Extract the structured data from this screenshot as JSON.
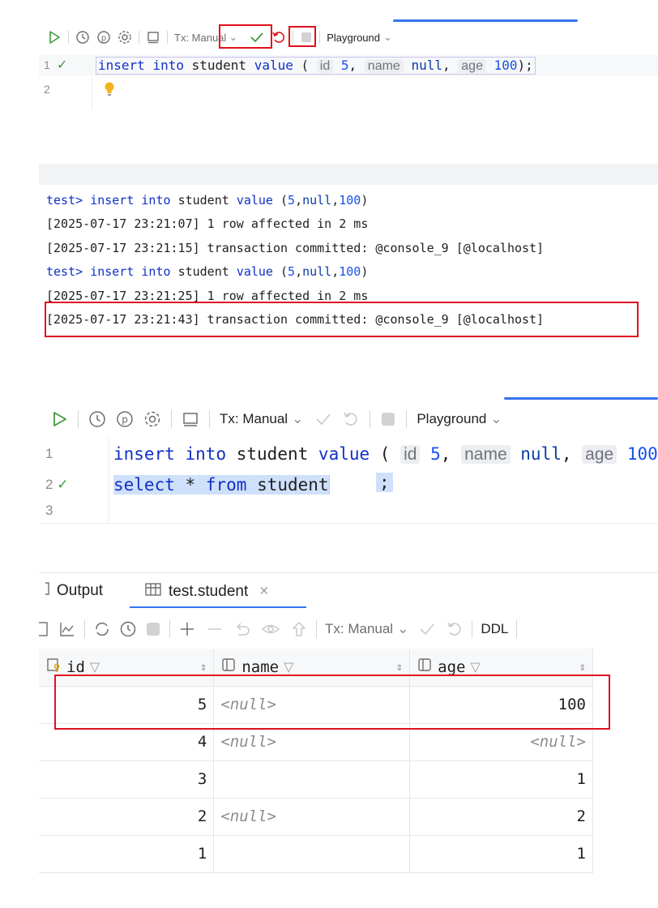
{
  "editor1": {
    "toolbar": {
      "tx_mode": "Tx: Manual",
      "playground": "Playground"
    },
    "lines": [
      {
        "number": "1",
        "status": "✓",
        "kw_insert": "insert",
        "kw_into": "into",
        "table": "student",
        "kw_value": "value",
        "paren_open": "(",
        "hint_id": "id",
        "val_id": "5",
        "comma1": ",",
        "hint_name": "name",
        "val_name": "null",
        "comma2": ",",
        "hint_age": "age",
        "val_age": "100",
        "paren_close": ");"
      },
      {
        "number": "2"
      }
    ]
  },
  "console": {
    "lines": [
      {
        "prompt": "test>",
        "kw1": "insert",
        "kw2": "into",
        "table": "student",
        "kw3": "value",
        "open": "(",
        "v1": "5",
        "c1": ",",
        "v2": "null",
        "c2": ",",
        "v3": "100",
        "close": ")"
      },
      {
        "text": "[2025-07-17 23:21:07] 1 row affected in 2 ms"
      },
      {
        "text": "[2025-07-17 23:21:15] transaction committed: @console_9 [@localhost]"
      },
      {
        "prompt": "test>",
        "kw1": "insert",
        "kw2": "into",
        "table": "student",
        "kw3": "value",
        "open": "(",
        "v1": "5",
        "c1": ",",
        "v2": "null",
        "c2": ",",
        "v3": "100",
        "close": ")"
      },
      {
        "text": "[2025-07-17 23:21:25] 1 row affected in 2 ms"
      },
      {
        "text": "[2025-07-17 23:21:43] transaction committed: @console_9 [@localhost]"
      }
    ]
  },
  "editor2": {
    "toolbar": {
      "tx_mode": "Tx: Manual",
      "playground": "Playground"
    },
    "lines": [
      {
        "number": "1",
        "kw_insert": "insert",
        "kw_into": "into",
        "table": "student",
        "kw_value": "value",
        "paren_open": "(",
        "hint_id": "id",
        "val_id": "5",
        "comma1": ",",
        "hint_name": "name",
        "val_name": "null",
        "comma2": ",",
        "hint_age": "age",
        "val_age": "100"
      },
      {
        "number": "2",
        "status": "✓",
        "kw_select": "select",
        "star": "*",
        "kw_from": "from",
        "table": "student",
        "semi": ";"
      },
      {
        "number": "3"
      }
    ]
  },
  "results": {
    "tabs": [
      {
        "label": "Output"
      },
      {
        "label": "test.student",
        "close": "×"
      }
    ],
    "toolbar": {
      "tx_mode": "Tx: Manual",
      "ddl": "DDL"
    },
    "columns": [
      "id",
      "name",
      "age"
    ],
    "rows": [
      {
        "id": "5",
        "name": "<null>",
        "age": "100"
      },
      {
        "id": "4",
        "name": "<null>",
        "age": "<null>"
      },
      {
        "id": "3",
        "name": "",
        "age": "1"
      },
      {
        "id": "2",
        "name": "<null>",
        "age": "2"
      },
      {
        "id": "1",
        "name": "",
        "age": "1"
      }
    ],
    "sort_glyph": "⇕"
  }
}
